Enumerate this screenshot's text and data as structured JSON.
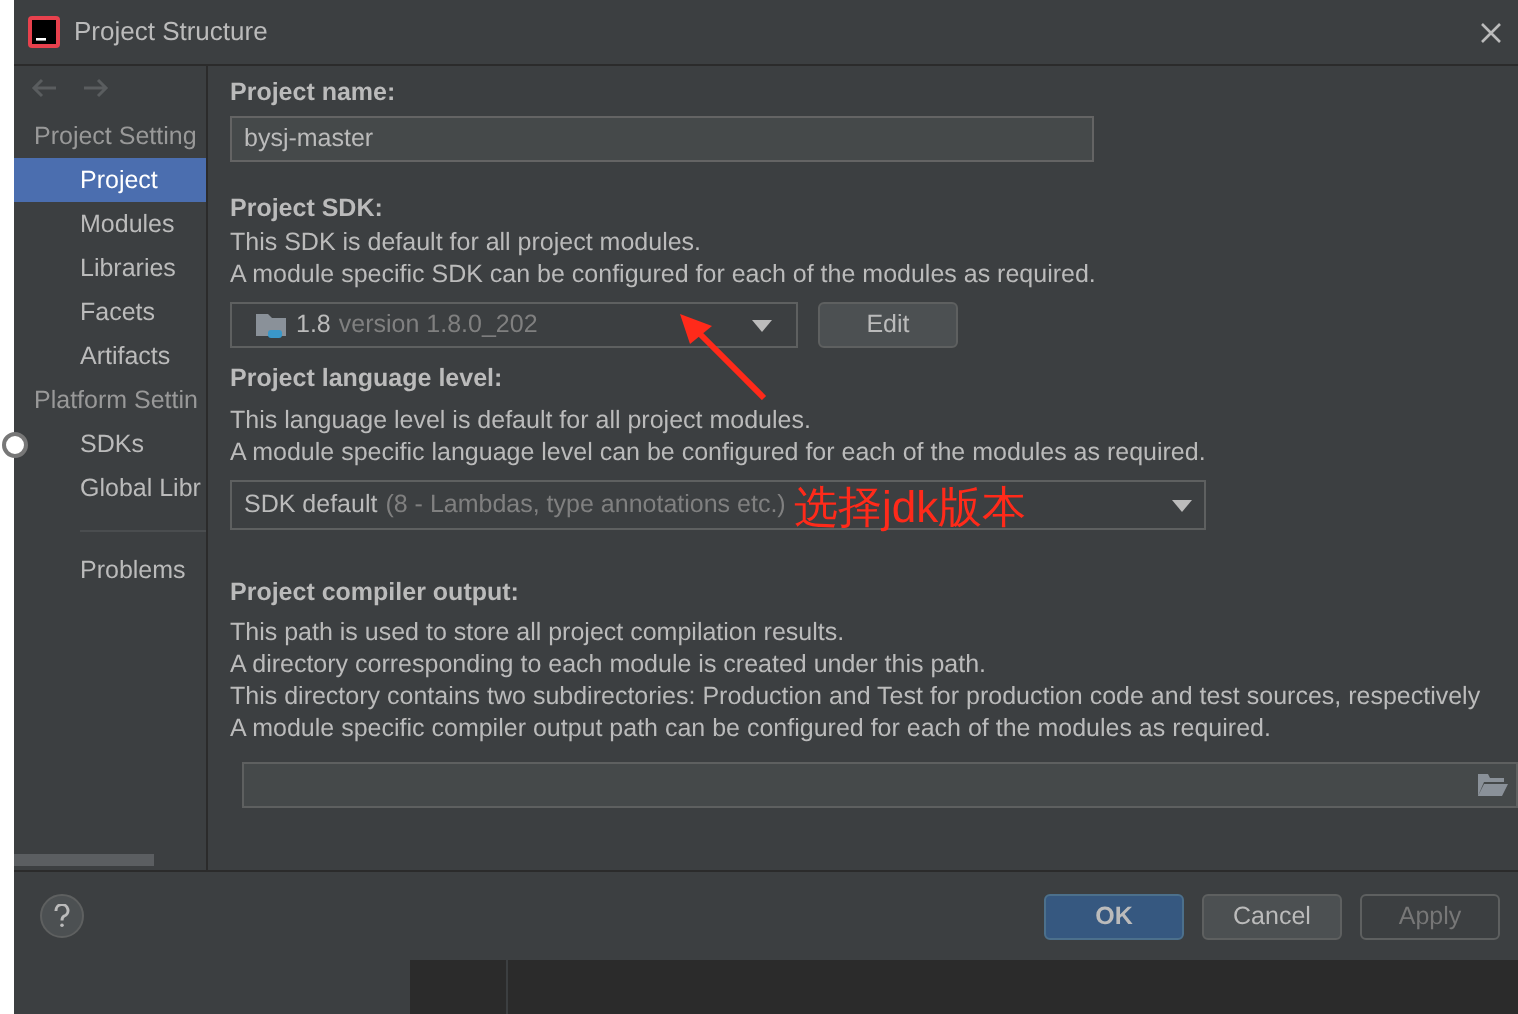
{
  "window": {
    "title": "Project Structure"
  },
  "sidebar": {
    "groups": [
      {
        "title": "Project Setting",
        "items": [
          {
            "label": "Project",
            "selected": true
          },
          {
            "label": "Modules",
            "selected": false
          },
          {
            "label": "Libraries",
            "selected": false
          },
          {
            "label": "Facets",
            "selected": false
          },
          {
            "label": "Artifacts",
            "selected": false
          }
        ]
      },
      {
        "title": "Platform Settin",
        "items": [
          {
            "label": "SDKs",
            "selected": false
          },
          {
            "label": "Global Libr",
            "selected": false
          }
        ]
      }
    ],
    "bottom_items": [
      {
        "label": "Problems",
        "selected": false
      }
    ]
  },
  "project_name": {
    "label": "Project name:",
    "value": "bysj-master"
  },
  "project_sdk": {
    "label": "Project SDK:",
    "description": [
      "This SDK is default for all project modules.",
      "A module specific SDK can be configured for each of the modules as required."
    ],
    "sdk_name": "1.8",
    "sdk_version": "version 1.8.0_202",
    "edit_button": "Edit"
  },
  "language_level": {
    "label": "Project language level:",
    "description": [
      "This language level is default for all project modules.",
      "A module specific language level can be configured for each of the modules as required."
    ],
    "value": "SDK default",
    "detail": "(8 - Lambdas, type annotations etc.)"
  },
  "compiler_output": {
    "label": "Project compiler output:",
    "description": [
      "This path is used to store all project compilation results.",
      "A directory corresponding to each module is created under this path.",
      "This directory contains two subdirectories: Production and Test for production code and test sources, respectively",
      "A module specific compiler output path can be configured for each of the modules as required."
    ]
  },
  "annotation": {
    "text": "选择jdk版本"
  },
  "buttons": [
    {
      "label": "OK",
      "kind": "primary",
      "disabled": false
    },
    {
      "label": "Cancel",
      "kind": "normal",
      "disabled": false
    },
    {
      "label": "Apply",
      "kind": "normal",
      "disabled": true
    }
  ]
}
